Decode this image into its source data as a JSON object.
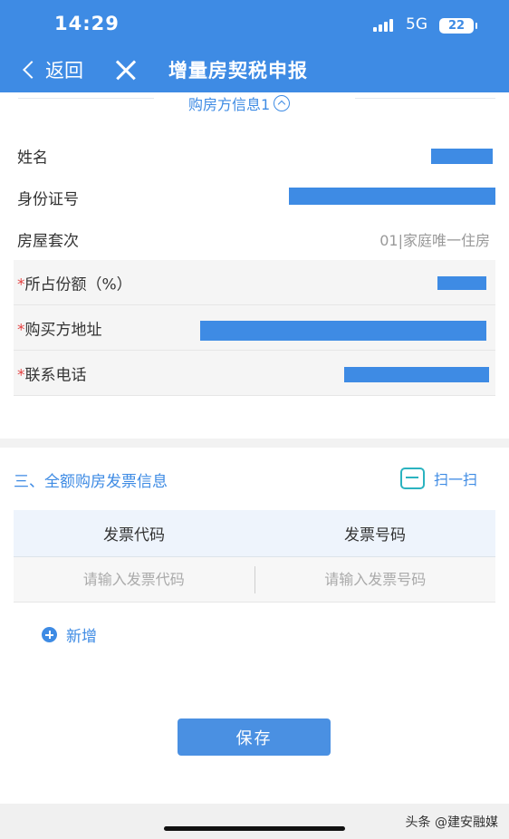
{
  "status_bar": {
    "time": "14:29",
    "network": "5G",
    "battery": "22"
  },
  "nav": {
    "back_label": "返回",
    "title": "增量房契税申报"
  },
  "buyer_section": {
    "title": "购房方信息1",
    "rows": [
      {
        "label": "姓名",
        "value": "",
        "required": ""
      },
      {
        "label": "身份证号",
        "value": "",
        "required": ""
      },
      {
        "label": "房屋套次",
        "value": "01|家庭唯一住房",
        "required": ""
      },
      {
        "label": "所占份额（%）",
        "value": "",
        "required": "*"
      },
      {
        "label": "购买方地址",
        "value": "",
        "required": "*"
      },
      {
        "label": "联系电话",
        "value": "",
        "required": "*"
      }
    ]
  },
  "invoice_section": {
    "title": "三、全额购房发票信息",
    "scan_label": "扫一扫",
    "columns": [
      "发票代码",
      "发票号码"
    ],
    "placeholders": [
      "请输入发票代码",
      "请输入发票号码"
    ],
    "add_label": "新增"
  },
  "save_label": "保存",
  "watermark": "头条 @建安融媒",
  "colors": {
    "primary": "#3e8be4",
    "required": "#e54545",
    "scan": "#2bb3c0"
  },
  "icons": [
    "signal-icon",
    "battery-icon",
    "back-chevron-icon",
    "close-icon",
    "collapse-icon",
    "scan-icon",
    "plus-circle-icon"
  ]
}
